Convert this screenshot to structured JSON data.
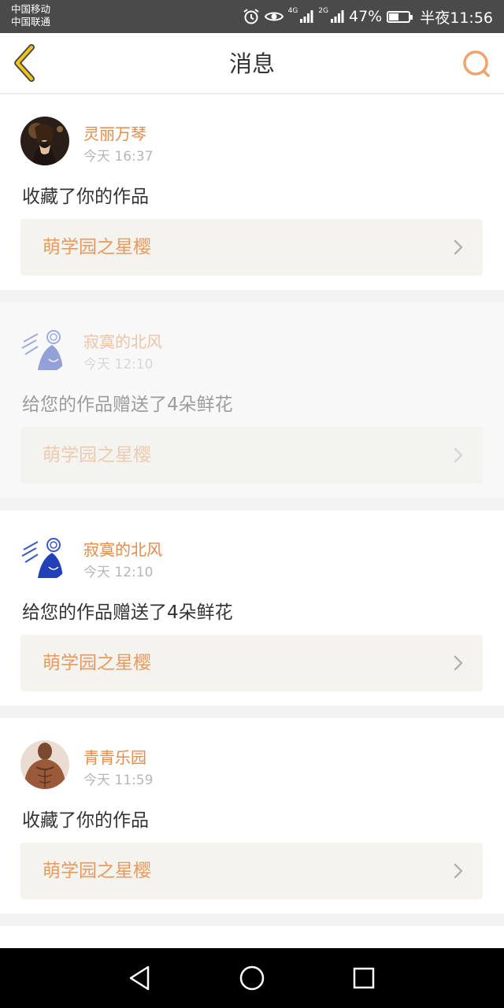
{
  "status_bar": {
    "carrier_1": "中国移动",
    "carrier_2": "中国联通",
    "net_1": "4G",
    "net_2": "2G",
    "battery": "47%",
    "time": "半夜11:56",
    "icons": [
      "alarm-icon",
      "eye-icon",
      "signal-icon",
      "signal-icon",
      "battery-icon"
    ]
  },
  "header": {
    "title": "消息",
    "back_icon": "chevron-left-icon",
    "search_icon": "search-icon",
    "accent_color": "#e8a23a"
  },
  "messages": [
    {
      "username": "灵丽万琴",
      "time": "今天 16:37",
      "text": "收藏了你的作品",
      "work": "萌学园之星樱",
      "faded": false
    },
    {
      "username": "寂寞的北风",
      "time": "今天 12:10",
      "text": "给您的作品赠送了4朵鲜花",
      "work": "萌学园之星樱",
      "faded": true
    },
    {
      "username": "寂寞的北风",
      "time": "今天 12:10",
      "text": "给您的作品赠送了4朵鲜花",
      "work": "萌学园之星樱",
      "faded": false
    },
    {
      "username": "青青乐园",
      "time": "今天 11:59",
      "text": "收藏了你的作品",
      "work": "萌学园之星樱",
      "faded": false
    }
  ],
  "colors": {
    "username": "#e88a4a",
    "work_title": "#e89a60",
    "work_bg": "#f4f3ee"
  },
  "nav_bar": {
    "icons": [
      "back-triangle-icon",
      "home-circle-icon",
      "recents-square-icon"
    ]
  }
}
